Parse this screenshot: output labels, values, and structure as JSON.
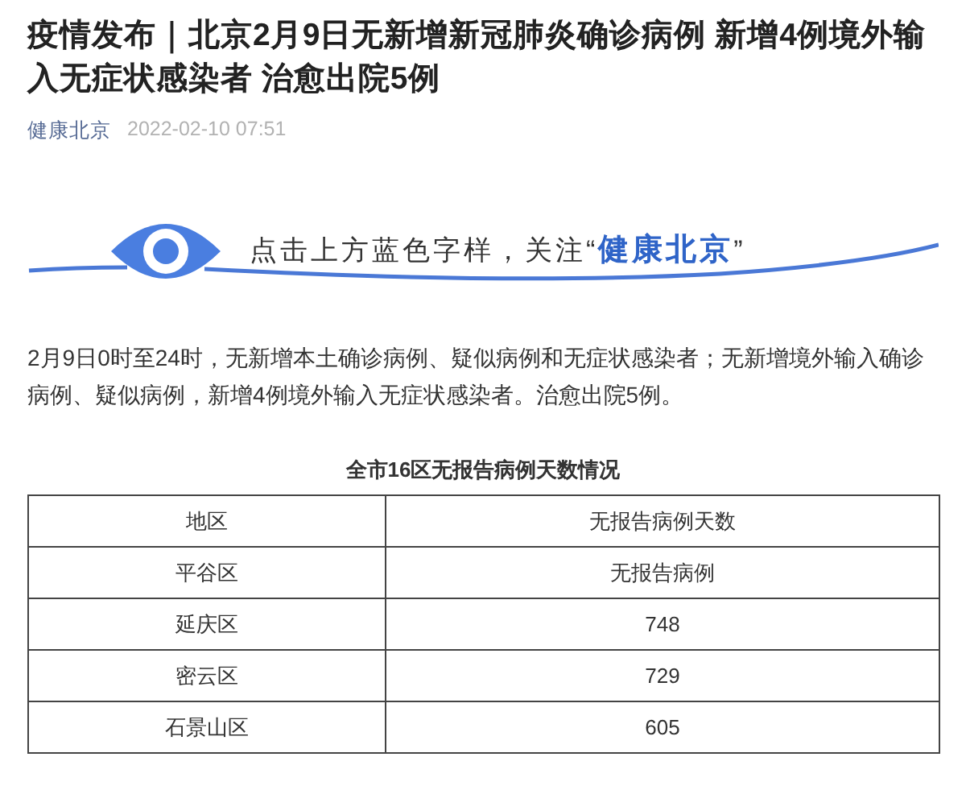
{
  "article": {
    "title": "疫情发布｜北京2月9日无新增新冠肺炎确诊病例 新增4例境外输入无症状感染者 治愈出院5例",
    "source": "健康北京",
    "date": "2022-02-10 07:51"
  },
  "banner": {
    "prefix": "点击上方蓝色字样，关注“",
    "highlight": "健康北京",
    "suffix": "”"
  },
  "paragraph": "2月9日0时至24时，无新增本土确诊病例、疑似病例和无症状感染者；无新增境外输入确诊病例、疑似病例，新增4例境外输入无症状感染者。治愈出院5例。",
  "table": {
    "caption": "全市16区无报告病例天数情况",
    "columns": [
      "地区",
      "无报告病例天数"
    ],
    "rows": [
      [
        "平谷区",
        "无报告病例"
      ],
      [
        "延庆区",
        "748"
      ],
      [
        "密云区",
        "729"
      ],
      [
        "石景山区",
        "605"
      ]
    ]
  }
}
